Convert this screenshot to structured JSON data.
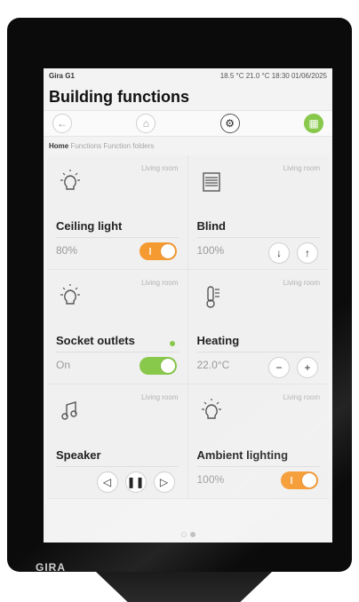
{
  "status": {
    "device": "Gira G1",
    "readout": "18.5 °C  21.0 °C  18:30  01/06/2025"
  },
  "title": "Building functions",
  "nav": [
    {
      "name": "back-icon",
      "glyph": "←"
    },
    {
      "name": "home-icon",
      "glyph": "⌂"
    },
    {
      "name": "settings-icon",
      "glyph": "⚙"
    },
    {
      "name": "grid-icon",
      "glyph": "▦"
    }
  ],
  "breadcrumb": {
    "home": "Home",
    "rest": "Functions  Function folders"
  },
  "tiles": [
    {
      "room": "Living room",
      "name": "Ceiling light",
      "value": "80%",
      "icon": "bulb-icon",
      "control": "toggle-orange"
    },
    {
      "room": "Living room",
      "name": "Blind",
      "value": "100%",
      "icon": "blind-icon",
      "control": "arrows"
    },
    {
      "room": "Living room",
      "name": "Socket outlets",
      "value": "On",
      "icon": "bulb-icon",
      "control": "toggle-green"
    },
    {
      "room": "Living room",
      "name": "Heating",
      "value": "22.0°C",
      "icon": "thermometer-icon",
      "control": "plusminus"
    },
    {
      "room": "Living room",
      "name": "Speaker",
      "value": "",
      "icon": "music-icon",
      "control": "media"
    },
    {
      "room": "Living room",
      "name": "Ambient lighting",
      "value": "100%",
      "icon": "bulb-icon",
      "control": "toggle-orange"
    }
  ],
  "brand": "GIRA",
  "colors": {
    "accent_orange": "#f59a31",
    "accent_green": "#88c84a"
  },
  "pager": {
    "active": 2,
    "count": 2
  }
}
